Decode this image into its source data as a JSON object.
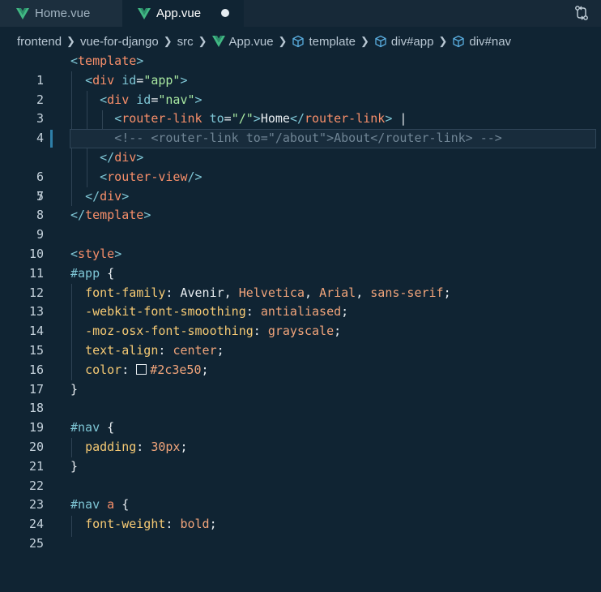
{
  "tabs": [
    {
      "label": "Home.vue",
      "active": false
    },
    {
      "label": "App.vue",
      "active": true,
      "dirty": true
    }
  ],
  "breadcrumb": {
    "items": [
      "frontend",
      "vue-for-django",
      "src",
      "App.vue",
      "template",
      "div#app",
      "div#nav"
    ]
  },
  "colors": {
    "vue_green": "#41b883",
    "background": "#102433",
    "tab_bar": "#172938"
  },
  "editor": {
    "line_numbers": [
      "1",
      "2",
      "3",
      "4",
      "5",
      "6",
      "7",
      "8",
      "9",
      "10",
      "11",
      "12",
      "13",
      "14",
      "15",
      "16",
      "17",
      "18",
      "19",
      "20",
      "21",
      "22",
      "23",
      "24",
      "25"
    ],
    "line1": {
      "open": "<",
      "tag": "template",
      "close": ">"
    },
    "line2": {
      "open": "<",
      "tag": "div",
      "attr": " id",
      "eq": "=",
      "val": "\"app\"",
      "close": ">"
    },
    "line3": {
      "open": "<",
      "tag": "div",
      "attr": " id",
      "eq": "=",
      "val": "\"nav\"",
      "close": ">"
    },
    "line4": {
      "open": "<",
      "tag": "router-link",
      "attr": " to",
      "eq": "=",
      "val": "\"/\"",
      "close": ">",
      "text": "Home",
      "open2": "</",
      "tag2": "router-link",
      "close2": ">",
      "cursor": " |"
    },
    "line5": {
      "comment": "<!-- <router-link to=\"/about\">About</router-link> -->"
    },
    "line6": {
      "open": "</",
      "tag": "div",
      "close": ">"
    },
    "line7": {
      "open": "<",
      "tag": "router-view",
      "close": "/>"
    },
    "line8": {
      "open": "</",
      "tag": "div",
      "close": ">"
    },
    "line9": {
      "open": "</",
      "tag": "template",
      "close": ">"
    },
    "line11": {
      "open": "<",
      "tag": "style",
      "close": ">"
    },
    "line12": {
      "selector": "#app",
      "brace": " {"
    },
    "line13": {
      "prop": "font-family",
      "colon": ": ",
      "v1": "Avenir",
      "c1": ", ",
      "v2": "Helvetica",
      "c2": ", ",
      "v3": "Arial",
      "c3": ", ",
      "v4": "sans-serif",
      "semi": ";"
    },
    "line14": {
      "prop": "-webkit-font-smoothing",
      "colon": ": ",
      "val": "antialiased",
      "semi": ";"
    },
    "line15": {
      "prop": "-moz-osx-font-smoothing",
      "colon": ": ",
      "val": "grayscale",
      "semi": ";"
    },
    "line16": {
      "prop": "text-align",
      "colon": ": ",
      "val": "center",
      "semi": ";"
    },
    "line17": {
      "prop": "color",
      "colon": ": ",
      "val": "#2c3e50",
      "semi": ";"
    },
    "line18": {
      "brace": "}"
    },
    "line20": {
      "selector": "#nav",
      "brace": " {"
    },
    "line21": {
      "prop": "padding",
      "colon": ": ",
      "val": "30px",
      "semi": ";"
    },
    "line22": {
      "brace": "}"
    },
    "line24": {
      "selector": "#nav",
      "el": " a",
      "brace": " {"
    },
    "line25": {
      "prop": "font-weight",
      "colon": ": ",
      "val": "bold",
      "semi": ";"
    }
  }
}
